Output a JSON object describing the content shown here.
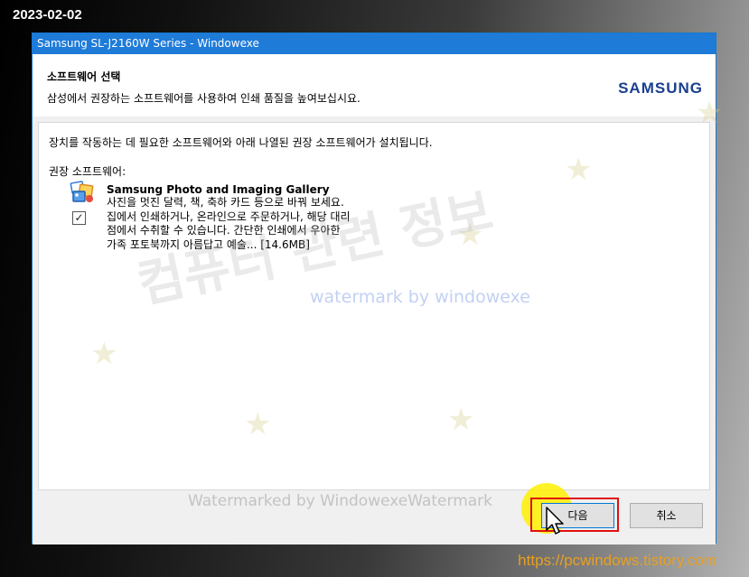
{
  "desktop": {
    "date": "2023-02-02",
    "url": "https://pcwindows.tistory.com"
  },
  "window": {
    "title": "Samsung SL-J2160W Series   - Windowexe"
  },
  "header": {
    "title": "소프트웨어 선택",
    "subtitle": "삼성에서 권장하는 소프트웨어를 사용하여 인쇄 품질을 높여보십시요.",
    "logo": "SAMSUNG"
  },
  "content": {
    "intro": "장치를 작동하는 데 필요한 소프트웨어와 아래 나열된 권장 소프트웨어가 설치됩니다.",
    "recommended_label": "권장 소프트웨어:",
    "software": [
      {
        "name": "Samsung Photo and Imaging Gallery",
        "checked": true,
        "description": [
          "사진을 멋진 달력, 책, 축하 카드 등으로 바꿔 보세요.",
          "집에서 인쇄하거나, 온라인으로 주문하거나, 해당 대리",
          "점에서 수취할 수 있습니다. 간단한 인쇄에서 우아한",
          "가족 포토북까지 아름답고 예술... [14.6MB]"
        ],
        "icon": "photo-gallery-icon"
      }
    ]
  },
  "buttons": {
    "next": "다음",
    "cancel": "취소"
  },
  "watermarks": {
    "main": "컴퓨터 관련 정보",
    "small": "watermark by windowexe",
    "bottom": "Watermarked by WindowexeWatermark"
  },
  "colors": {
    "titlebar": "#1f7bd8",
    "samsung_logo": "#1a3f8f",
    "highlight": "#e01010",
    "url_text": "#e8a020"
  }
}
